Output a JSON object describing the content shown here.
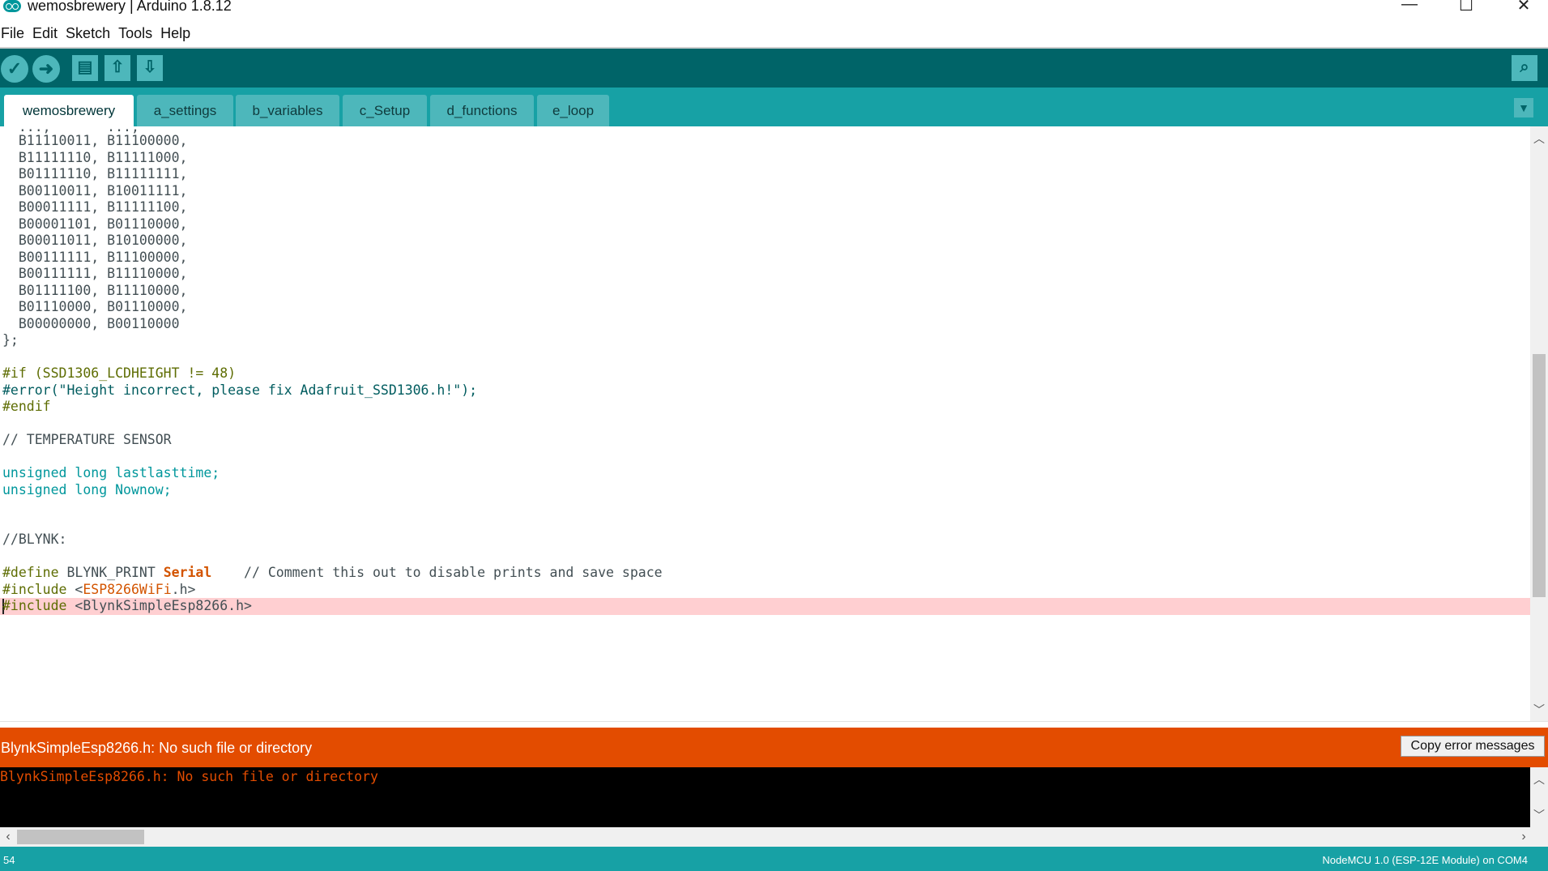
{
  "window": {
    "title": "wemosbrewery | Arduino 1.8.12",
    "controls": {
      "minimize": "—",
      "maximize": "☐",
      "close": "✕"
    }
  },
  "menu": {
    "items": [
      "File",
      "Edit",
      "Sketch",
      "Tools",
      "Help"
    ]
  },
  "toolbar": {
    "verify_icon": "checkmark-icon",
    "upload_icon": "arrow-right-icon",
    "new_icon": "document-icon",
    "open_icon": "arrow-up-icon",
    "save_icon": "arrow-down-icon",
    "serial_monitor_icon": "magnifier-icon"
  },
  "tabs": [
    {
      "label": "wemosbrewery",
      "active": true
    },
    {
      "label": "a_settings",
      "active": false
    },
    {
      "label": "b_variables",
      "active": false
    },
    {
      "label": "c_Setup",
      "active": false
    },
    {
      "label": "d_functions",
      "active": false
    },
    {
      "label": "e_loop",
      "active": false
    }
  ],
  "editor": {
    "lines": [
      "  B11110011, B11100000,",
      "  B11111110, B11111000,",
      "  B01111110, B11111111,",
      "  B00110011, B10011111,",
      "  B00011111, B11111100,",
      "  B00001101, B01110000,",
      "  B00011011, B10100000,",
      "  B00111111, B11100000,",
      "  B00111111, B11110000,",
      "  B01111100, B11110000,",
      "  B01110000, B01110000,",
      "  B00000000, B00110000",
      "};",
      "",
      "#if (SSD1306_LCDHEIGHT != 48)",
      "#error(\"Height incorrect, please fix Adafruit_SSD1306.h!\");",
      "#endif",
      "",
      "// TEMPERATURE SENSOR",
      "",
      "unsigned long lastlasttime;",
      "unsigned long Nownow;",
      "",
      "",
      "//BLYNK:",
      "",
      "#define BLYNK_PRINT Serial    // Comment this out to disable prints and save space",
      "#include <ESP8266WiFi.h>",
      "#include <BlynkSimpleEsp8266.h>"
    ],
    "highlighted_line_index": 28
  },
  "error": {
    "title": "BlynkSimpleEsp8266.h: No such file or directory",
    "copy_button": "Copy error messages",
    "console_text": "BlynkSimpleEsp8266.h: No such file or directory"
  },
  "status": {
    "line_number": "54",
    "board": "NodeMCU 1.0 (ESP-12E Module) on COM4"
  },
  "colors": {
    "toolbar": "#006468",
    "tabbar": "#17a1a5",
    "error_bar": "#e34c00",
    "highlight": "#ffcfd1"
  }
}
